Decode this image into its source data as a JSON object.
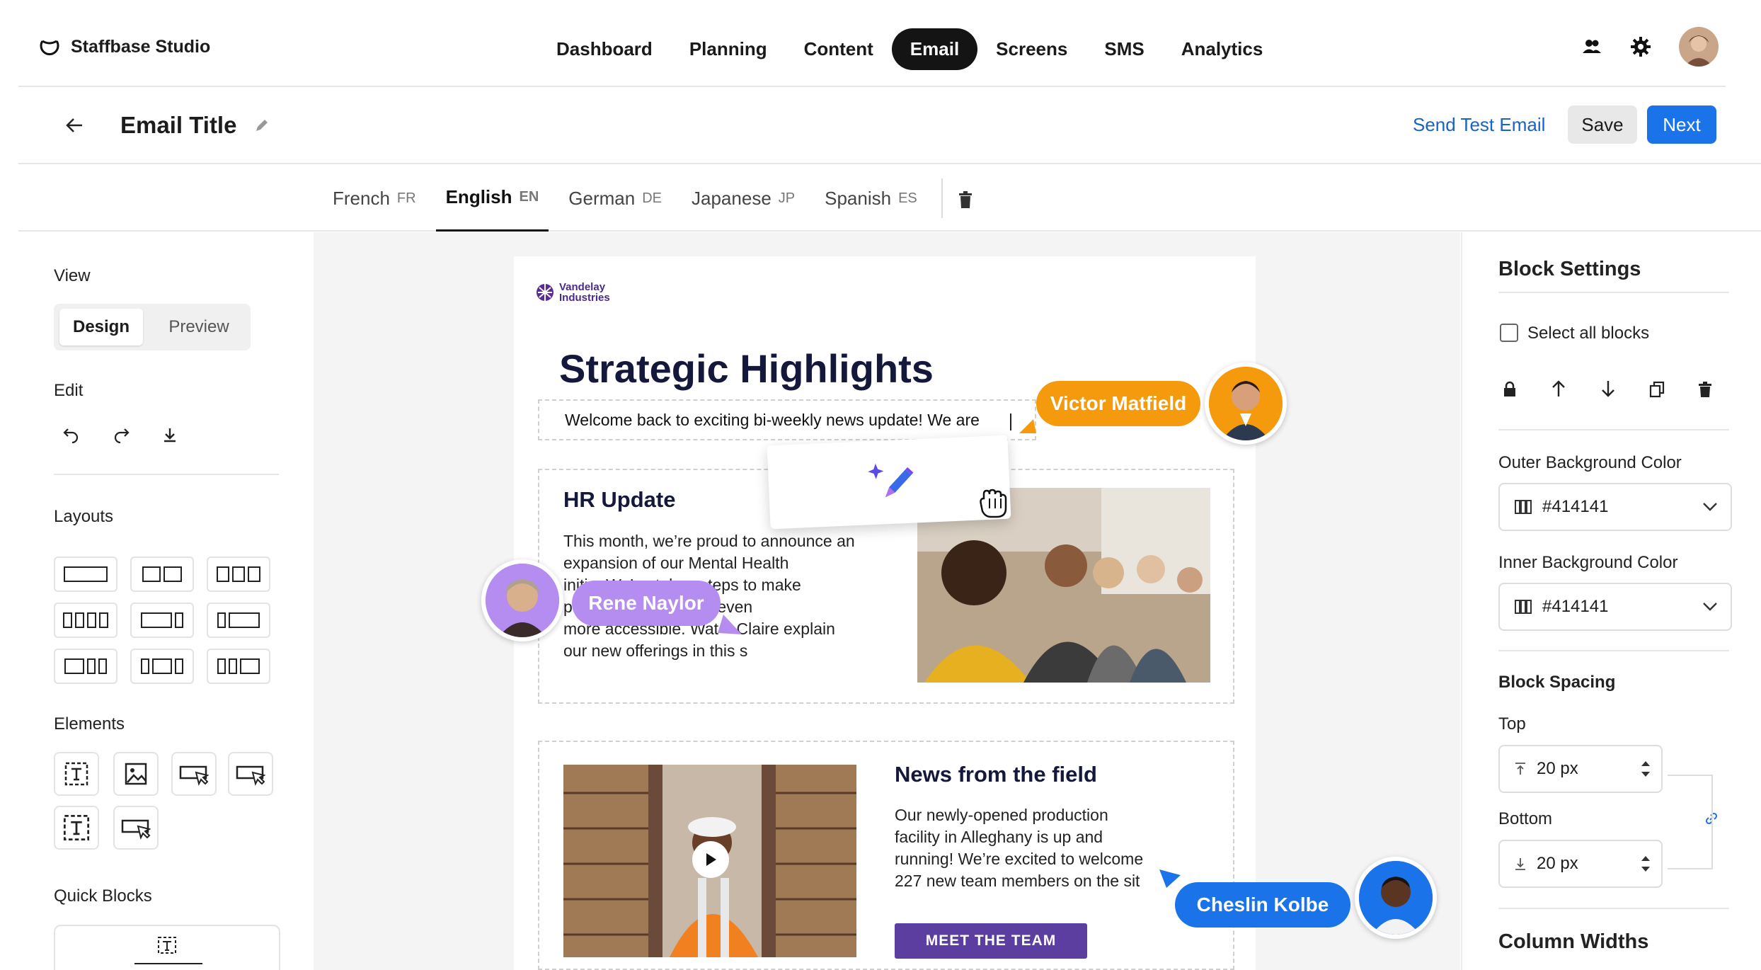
{
  "app": {
    "name": "Staffbase Studio"
  },
  "nav": {
    "items": [
      "Dashboard",
      "Planning",
      "Content",
      "Email",
      "Screens",
      "SMS",
      "Analytics"
    ],
    "active": "Email"
  },
  "header": {
    "title": "Email Title",
    "send_test": "Send Test Email",
    "save": "Save",
    "next": "Next"
  },
  "languages": [
    {
      "name": "French",
      "code": "FR"
    },
    {
      "name": "English",
      "code": "EN",
      "active": true
    },
    {
      "name": "German",
      "code": "DE"
    },
    {
      "name": "Japanese",
      "code": "JP"
    },
    {
      "name": "Spanish",
      "code": "ES"
    }
  ],
  "left": {
    "view_label": "View",
    "design": "Design",
    "preview": "Preview",
    "edit_label": "Edit",
    "layouts_label": "Layouts",
    "elements_label": "Elements",
    "quick_blocks_label": "Quick Blocks"
  },
  "email": {
    "brand_line1": "Vandelay",
    "brand_line2": "Industries",
    "heading": "Strategic Highlights",
    "welcome": "Welcome back to exciting bi-weekly news update! We are",
    "hr_title": "HR Update",
    "hr_body": [
      "This month, we’re proud to announce an",
      "expansion of our Mental Health",
      "initi    We’ve taken steps to make",
      "p              nd support even",
      "more accessible. Wat    Claire explain",
      "our new offerings in this s"
    ],
    "news_title": "News from the field",
    "news_body": [
      "Our newly-opened production",
      "facility in Alleghany is up and",
      "running! We’re excited to welcome",
      "227 new team members on the sit"
    ],
    "cta": "MEET THE TEAM"
  },
  "collaborators": {
    "victor": "Victor Matfield",
    "rene": "Rene Naylor",
    "cheslin": "Cheslin Kolbe"
  },
  "right": {
    "title": "Block Settings",
    "select_all": "Select all blocks",
    "outer_bg_label": "Outer Background Color",
    "outer_bg_value": "#414141",
    "inner_bg_label": "Inner Background Color",
    "inner_bg_value": "#414141",
    "spacing_label": "Block Spacing",
    "top_label": "Top",
    "top_value": "20 px",
    "bottom_label": "Bottom",
    "bottom_value": "20 px",
    "column_widths": "Column Widths"
  },
  "colors": {
    "accent": "#1a73e8",
    "orange": "#f59a0c",
    "purple": "#b58cf0",
    "blue": "#1a73e8",
    "cta": "#5b3ea0",
    "heading": "#14183a"
  }
}
